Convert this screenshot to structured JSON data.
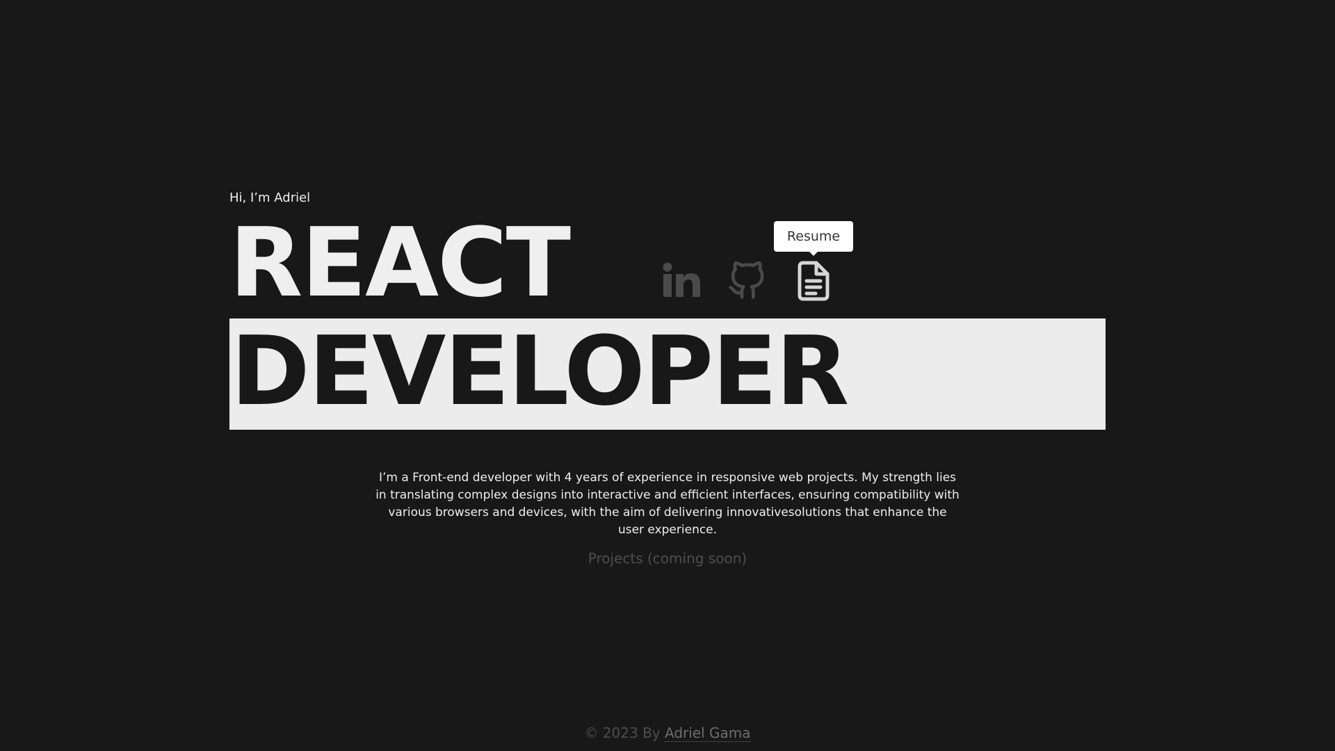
{
  "hero": {
    "greeting": "Hi, I’m Adriel",
    "title_line1": "REACT",
    "title_line2": "DEVELOPER"
  },
  "social": {
    "linkedin_icon": "linkedin-icon",
    "github_icon": "github-icon",
    "resume_icon": "document-icon",
    "resume_tooltip": "Resume"
  },
  "bio": {
    "text": "I’m a Front-end developer with 4 years of experience in responsive web projects. My strength lies in translating complex designs into interactive and efficient interfaces, ensuring compatibility with various browsers and devices, with the aim of delivering innovativesolutions that enhance the user experience."
  },
  "projects": {
    "label": "Projects (coming soon)"
  },
  "footer": {
    "prefix": "© 2023 By ",
    "author_link": "Adriel Gama"
  },
  "colors": {
    "background": "#181818",
    "foreground": "#efefef",
    "muted": "#4e4e4e",
    "band": "#ececec"
  }
}
